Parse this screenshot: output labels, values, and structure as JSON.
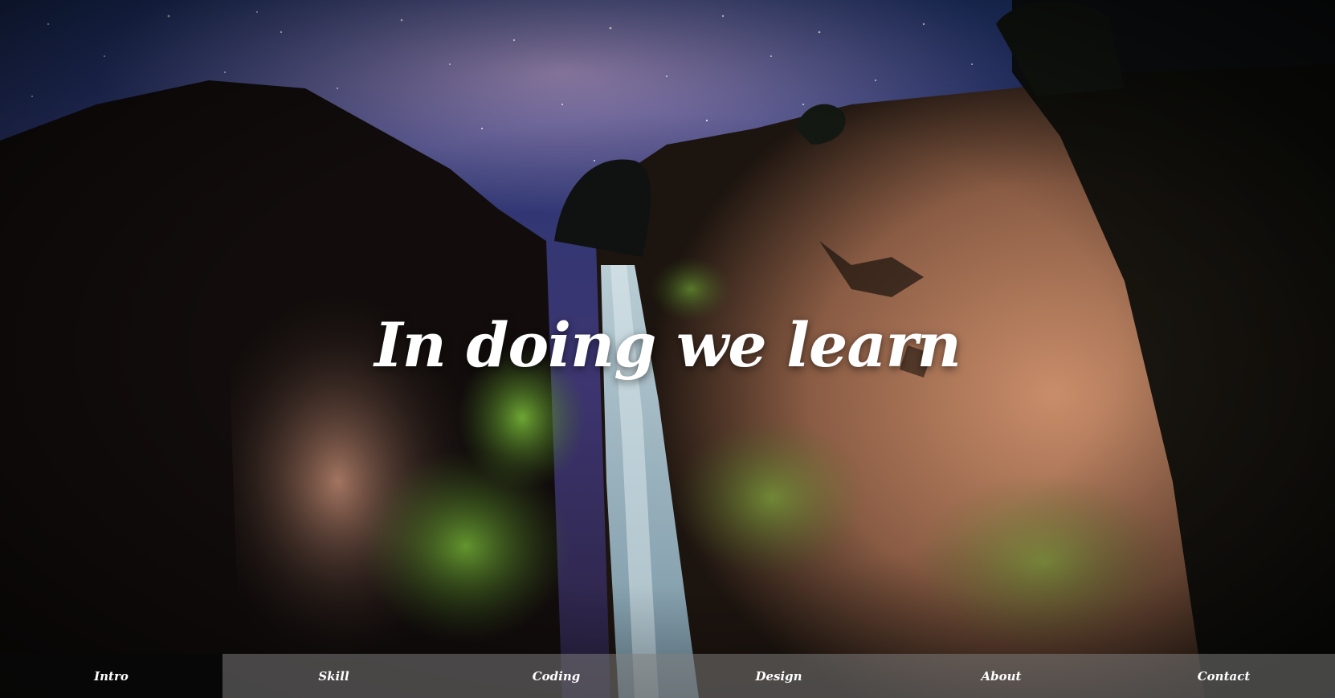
{
  "hero": {
    "title": "In doing we learn"
  },
  "nav": {
    "items": [
      {
        "label": "Intro",
        "active": true
      },
      {
        "label": "Skill",
        "active": false
      },
      {
        "label": "Coding",
        "active": false
      },
      {
        "label": "Design",
        "active": false
      },
      {
        "label": "About",
        "active": false
      },
      {
        "label": "Contact",
        "active": false
      }
    ]
  },
  "colors": {
    "nav_active_bg": "#050505",
    "nav_bg": "#808080",
    "text": "#ffffff",
    "sky": "#3a3a78",
    "rock": "#b07a5c",
    "moss": "#6aa23a",
    "water": "#a9c6d6"
  }
}
